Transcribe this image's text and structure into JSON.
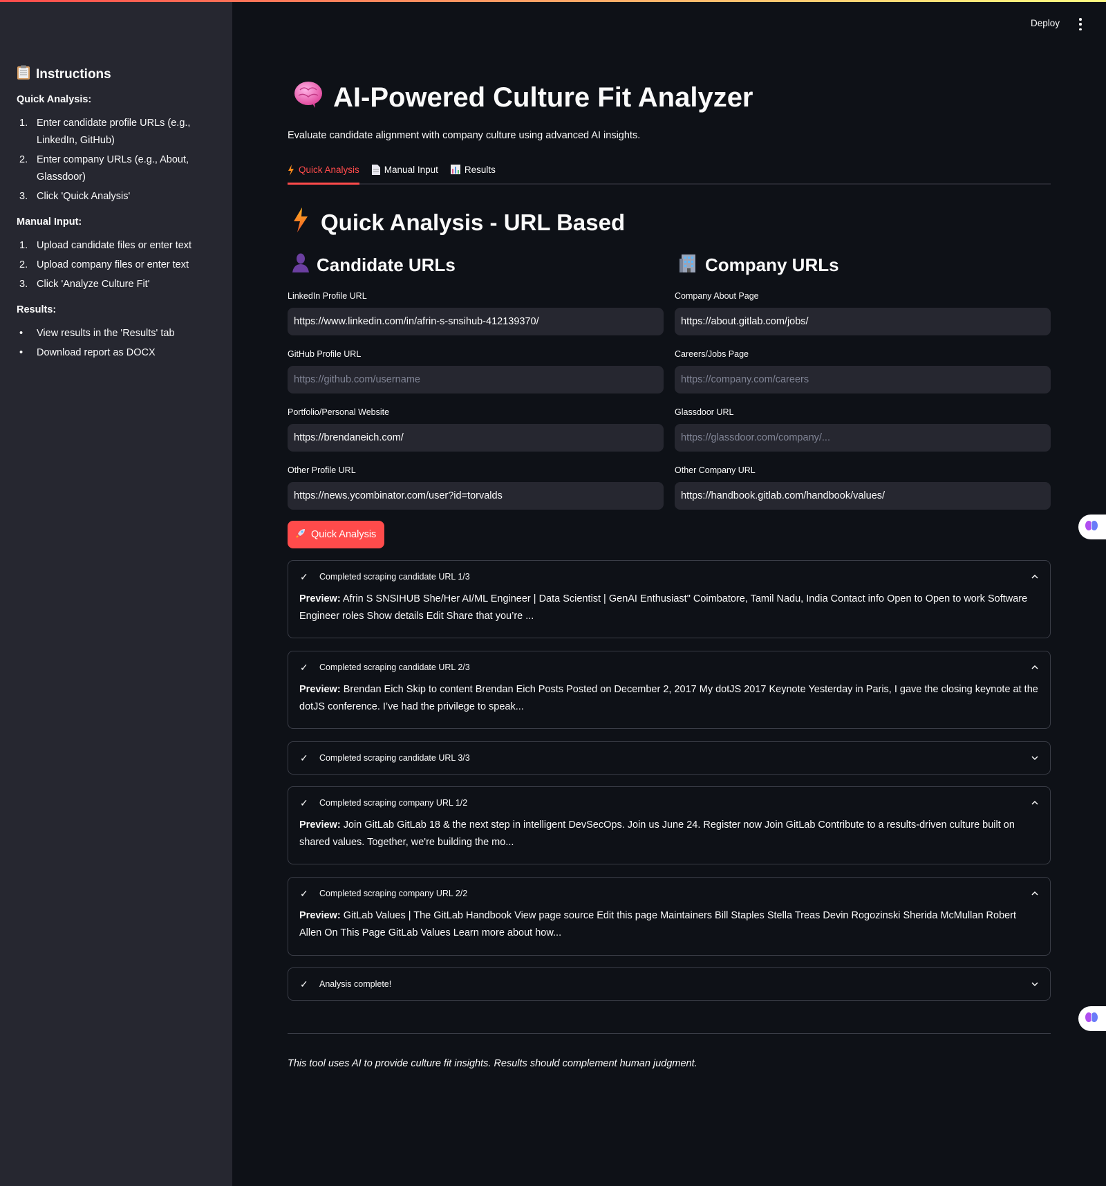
{
  "sidebar": {
    "title": "Instructions",
    "sections": [
      {
        "heading": "Quick Analysis:",
        "items": [
          {
            "n": "1.",
            "text": "Enter candidate profile URLs (e.g., LinkedIn, GitHub)"
          },
          {
            "n": "2.",
            "text": "Enter company URLs (e.g., About, Glassdoor)"
          },
          {
            "n": "3.",
            "text": "Click 'Quick Analysis'"
          }
        ]
      },
      {
        "heading": "Manual Input:",
        "items": [
          {
            "n": "1.",
            "text": "Upload candidate files or enter text"
          },
          {
            "n": "2.",
            "text": "Upload company files or enter text"
          },
          {
            "n": "3.",
            "text": "Click 'Analyze Culture Fit'"
          }
        ]
      },
      {
        "heading": "Results:",
        "items": [
          {
            "n": "•",
            "text": "View results in the 'Results' tab"
          },
          {
            "n": "•",
            "text": "Download report as DOCX"
          }
        ]
      }
    ]
  },
  "header": {
    "deploy": "Deploy"
  },
  "main": {
    "title": "AI-Powered Culture Fit Analyzer",
    "subtitle": "Evaluate candidate alignment with company culture using advanced AI insights.",
    "tabs": [
      {
        "label": "Quick Analysis",
        "active": true
      },
      {
        "label": "Manual Input"
      },
      {
        "label": "Results"
      }
    ],
    "section_title": "Quick Analysis - URL Based",
    "candidate": {
      "heading": "Candidate URLs",
      "fields": [
        {
          "label": "LinkedIn Profile URL",
          "value": "https://www.linkedin.com/in/afrin-s-snsihub-412139370/",
          "placeholder": ""
        },
        {
          "label": "GitHub Profile URL",
          "value": "",
          "placeholder": "https://github.com/username"
        },
        {
          "label": "Portfolio/Personal Website",
          "value": "https://brendaneich.com/",
          "placeholder": ""
        },
        {
          "label": "Other Profile URL",
          "value": "https://news.ycombinator.com/user?id=torvalds",
          "placeholder": ""
        }
      ]
    },
    "company": {
      "heading": "Company URLs",
      "fields": [
        {
          "label": "Company About Page",
          "value": "https://about.gitlab.com/jobs/",
          "placeholder": ""
        },
        {
          "label": "Careers/Jobs Page",
          "value": "",
          "placeholder": "https://company.com/careers"
        },
        {
          "label": "Glassdoor URL",
          "value": "",
          "placeholder": "https://glassdoor.com/company/..."
        },
        {
          "label": "Other Company URL",
          "value": "https://handbook.gitlab.com/handbook/values/",
          "placeholder": ""
        }
      ]
    },
    "button": "Quick Analysis",
    "status": [
      {
        "label": "Completed scraping candidate URL 1/3",
        "expanded": true,
        "preview_label": "Preview:",
        "preview": "Afrin S SNSIHUB She/Her AI/ML Engineer | Data Scientist | GenAI Enthusiast\" Coimbatore, Tamil Nadu, India Contact info Open to Open to work Software Engineer roles Show details Edit Share that you’re ..."
      },
      {
        "label": "Completed scraping candidate URL 2/3",
        "expanded": true,
        "preview_label": "Preview:",
        "preview": "Brendan Eich Skip to content Brendan Eich Posts Posted on December 2, 2017 My dotJS 2017 Keynote Yesterday in Paris, I gave the closing keynote at the dotJS conference. I’ve had the privilege to speak..."
      },
      {
        "label": "Completed scraping candidate URL 3/3",
        "expanded": false
      },
      {
        "label": "Completed scraping company URL 1/2",
        "expanded": true,
        "preview_label": "Preview:",
        "preview": "Join GitLab GitLab 18 & the next step in intelligent DevSecOps. Join us June 24. Register now Join GitLab Contribute to a results-driven culture built on shared values. Together, we're building the mo..."
      },
      {
        "label": "Completed scraping company URL 2/2",
        "expanded": true,
        "preview_label": "Preview:",
        "preview": "GitLab Values | The GitLab Handbook View page source Edit this page Maintainers Bill Staples Stella Treas Devin Rogozinski Sherida McMullan Robert Allen On This Page GitLab Values Learn more about how..."
      },
      {
        "label": "Analysis complete!",
        "expanded": false
      }
    ],
    "footer": "This tool uses AI to provide culture fit insights. Results should complement human judgment."
  },
  "colors": {
    "accent": "#ff4b4b",
    "bg": "#0e1117",
    "sidebar": "#262730",
    "input": "#262730"
  }
}
